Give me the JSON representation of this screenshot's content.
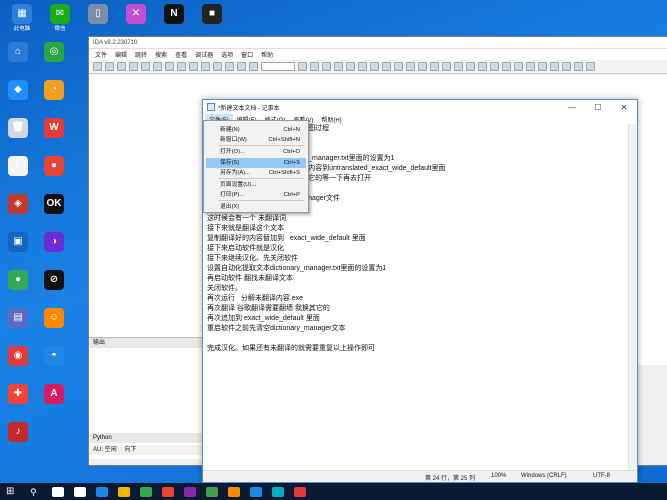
{
  "desktop": {
    "icons": [
      {
        "label": "此电脑",
        "color": "#2f7fd8",
        "glyph": "▦"
      },
      {
        "label": "微信",
        "color": "#1aad19",
        "glyph": "✉"
      },
      {
        "label": "",
        "color": "#7a8ea8",
        "glyph": "▯"
      },
      {
        "label": "",
        "color": "#c24fd1",
        "glyph": "✕"
      },
      {
        "label": "",
        "color": "#111",
        "glyph": "N"
      },
      {
        "label": "",
        "color": "#222",
        "glyph": "■"
      },
      {
        "label": "",
        "color": "#2b7ad6",
        "glyph": "⌂"
      },
      {
        "label": "",
        "color": "#28a745",
        "glyph": "◎"
      },
      {
        "label": "",
        "color": "#1e90ff",
        "glyph": "◆"
      },
      {
        "label": "",
        "color": "#f0a020",
        "glyph": "◔"
      },
      {
        "label": "",
        "color": "#cfd8e6",
        "glyph": "🗑"
      },
      {
        "label": "",
        "color": "#e53935",
        "glyph": "W"
      },
      {
        "label": "",
        "color": "#f5f5f5",
        "glyph": "◐"
      },
      {
        "label": "",
        "color": "#ea4335",
        "glyph": "●"
      },
      {
        "label": "",
        "color": "#c0392b",
        "glyph": "◈"
      },
      {
        "label": "",
        "color": "#111",
        "glyph": "OK"
      },
      {
        "label": "",
        "color": "#1565c0",
        "glyph": "▣"
      },
      {
        "label": "",
        "color": "#6c2bd9",
        "glyph": "◑"
      },
      {
        "label": "",
        "color": "#34a853",
        "glyph": "●"
      },
      {
        "label": "",
        "color": "#111",
        "glyph": "⊘"
      },
      {
        "label": "",
        "color": "#5c6bc0",
        "glyph": "▤"
      },
      {
        "label": "",
        "color": "#ff8a00",
        "glyph": "☺"
      },
      {
        "label": "",
        "color": "#e53935",
        "glyph": "◉"
      },
      {
        "label": "",
        "color": "#1e88e5",
        "glyph": "◓"
      },
      {
        "label": "",
        "color": "#f44336",
        "glyph": "✚"
      },
      {
        "label": "",
        "color": "#d81b60",
        "glyph": "A"
      },
      {
        "label": "",
        "color": "#c62828",
        "glyph": "♪"
      }
    ]
  },
  "ida": {
    "title": "IDA v8.2.230710",
    "menu": [
      "文件",
      "编辑",
      "跳转",
      "搜索",
      "查看",
      "调试器",
      "选项",
      "窗口",
      "帮助"
    ],
    "output_title": "输出",
    "python_tab": "Python",
    "status_left": "AU: 空闲",
    "status_right": "向下"
  },
  "notepad": {
    "title": "*新建文本文档 - 记事本",
    "controls": [
      "—",
      "☐",
      "✕"
    ],
    "menu": [
      "文件(F)",
      "编辑(E)",
      "格式(O)",
      "查看(V)",
      "帮助(H)"
    ],
    "lines": [
      "                                                    图过程",
      "",
      "",
      "                                                    _manager.txt里面的设置为1",
      "                                                    内容到untranslated_exact_wide_default里面",
      "                                                    它的等一下再去打开",
      "",
      "                                                    nager文件",
      "运行 分解未翻译内容.exe",
      "这时候会有一个 未翻译词",
      "接下来就是翻译这个文本",
      "复制翻译好的内容替加到   exact_wide_default 里面",
      "接下来启动软件就是汉化",
      "接下来继续汉化。先关闭软件",
      "设置自动化提取文本dictionary_manager.txt里面的设置为1",
      "再启动软件 翻找未翻译文本",
      "关闭软件。",
      "再次运行   分解未翻译内容.exe",
      "再次翻译 谷歌翻译需要翻墙 我换其它的",
      "再次追加到 exact_wide_default 里面",
      "重启软件之前先清空dictionary_manager文本",
      "",
      "完成汉化。如果还有未翻译的就需要重复以上操作即可"
    ],
    "status": {
      "position": "第 24 行，第 25 列",
      "zoom": "100%",
      "eol": "Windows (CRLF)",
      "encoding": "UTF-8"
    }
  },
  "file_menu": {
    "items": [
      {
        "label": "新建(N)",
        "shortcut": "Ctrl+N"
      },
      {
        "label": "新窗口(W)",
        "shortcut": "Ctrl+Shift+N"
      },
      {
        "label": "打开(O)...",
        "shortcut": "Ctrl+O"
      },
      {
        "label": "保存(S)",
        "shortcut": "Ctrl+S",
        "highlight": true
      },
      {
        "label": "另存为(A)...",
        "shortcut": "Ctrl+Shift+S"
      },
      {
        "label": "页面设置(U)...",
        "shortcut": ""
      },
      {
        "label": "打印(P)...",
        "shortcut": "Ctrl+P"
      },
      {
        "label": "退出(X)",
        "shortcut": ""
      }
    ]
  },
  "taskbar": {
    "icons": [
      "#ffffff",
      "#ffffff",
      "#1e88e5",
      "#f4b400",
      "#34a853",
      "#ea4335",
      "#8e24aa",
      "#43a047",
      "#fb8c00",
      "#1e88e5",
      "#00acc1",
      "#e53935"
    ]
  }
}
